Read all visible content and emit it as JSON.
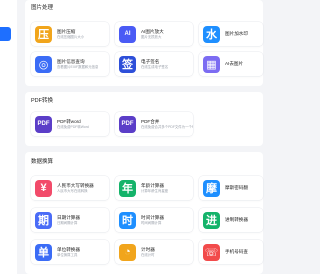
{
  "sections": {
    "image": {
      "title": "图片处理",
      "tools": [
        {
          "name": "图片压缩",
          "desc": "在线压缩图片大小",
          "glyph": "压",
          "icon": "compress-icon",
          "color": "#f1a51c"
        },
        {
          "name": "AI图片放大",
          "desc": "图片无损放大",
          "glyph": "AI",
          "icon": "ai-upscale-icon",
          "color": "#4a5bf5"
        },
        {
          "name": "图片加水印",
          "desc": "",
          "glyph": "水",
          "icon": "watermark-icon",
          "color": "#1e8fff"
        },
        {
          "name": "图片信息查询",
          "desc": "查看图片EXIF数据和元信息",
          "glyph": "◎",
          "icon": "image-info-icon",
          "color": "#3b6cf6"
        },
        {
          "name": "电子签名",
          "desc": "在线生成电子签名",
          "glyph": "签",
          "icon": "signature-icon",
          "color": "#2e4fd9"
        },
        {
          "name": "AI去图片",
          "desc": "",
          "glyph": "▦",
          "icon": "ai-remove-icon",
          "color": "#7c6cf2"
        }
      ]
    },
    "pdf": {
      "title": "PDF转换",
      "tools": [
        {
          "name": "PDF转word",
          "desc": "在线免费PDF转Word",
          "glyph": "PDF",
          "icon": "pdf-to-word-icon",
          "color": "#5b3ec8"
        },
        {
          "name": "PDF合并",
          "desc": "在线免费合并多个PDF文件为一个PDF",
          "glyph": "PDF",
          "icon": "pdf-merge-icon",
          "color": "#5b3ec8"
        }
      ]
    },
    "data": {
      "title": "数据换算",
      "tools": [
        {
          "name": "人民币大写转换器",
          "desc": "人民币大写在线转换",
          "glyph": "¥",
          "icon": "rmb-icon",
          "color": "#f24b6a"
        },
        {
          "name": "年龄计算器",
          "desc": "计算年龄生肖星座",
          "glyph": "年",
          "icon": "age-icon",
          "color": "#14b36a"
        },
        {
          "name": "摩斯密码翻",
          "desc": "",
          "glyph": "摩",
          "icon": "morse-icon",
          "color": "#1e8fff"
        },
        {
          "name": "日期计算器",
          "desc": "日期间隔计算",
          "glyph": "期",
          "icon": "date-icon",
          "color": "#4a6cf7"
        },
        {
          "name": "时间计算器",
          "desc": "时间间隔计算",
          "glyph": "时",
          "icon": "time-icon",
          "color": "#1e8fff"
        },
        {
          "name": "进制转换器",
          "desc": "",
          "glyph": "进",
          "icon": "base-convert-icon",
          "color": "#14b36a"
        },
        {
          "name": "单位转换器",
          "desc": "单位换算工具",
          "glyph": "单",
          "icon": "unit-icon",
          "color": "#3b6cf6"
        },
        {
          "name": "计时器",
          "desc": "在线计时",
          "glyph": "◔",
          "icon": "timer-icon",
          "color": "#f1a51c"
        },
        {
          "name": "手机号码查",
          "desc": "",
          "glyph": "☏",
          "icon": "phone-icon",
          "color": "#f24b4b"
        }
      ]
    }
  }
}
